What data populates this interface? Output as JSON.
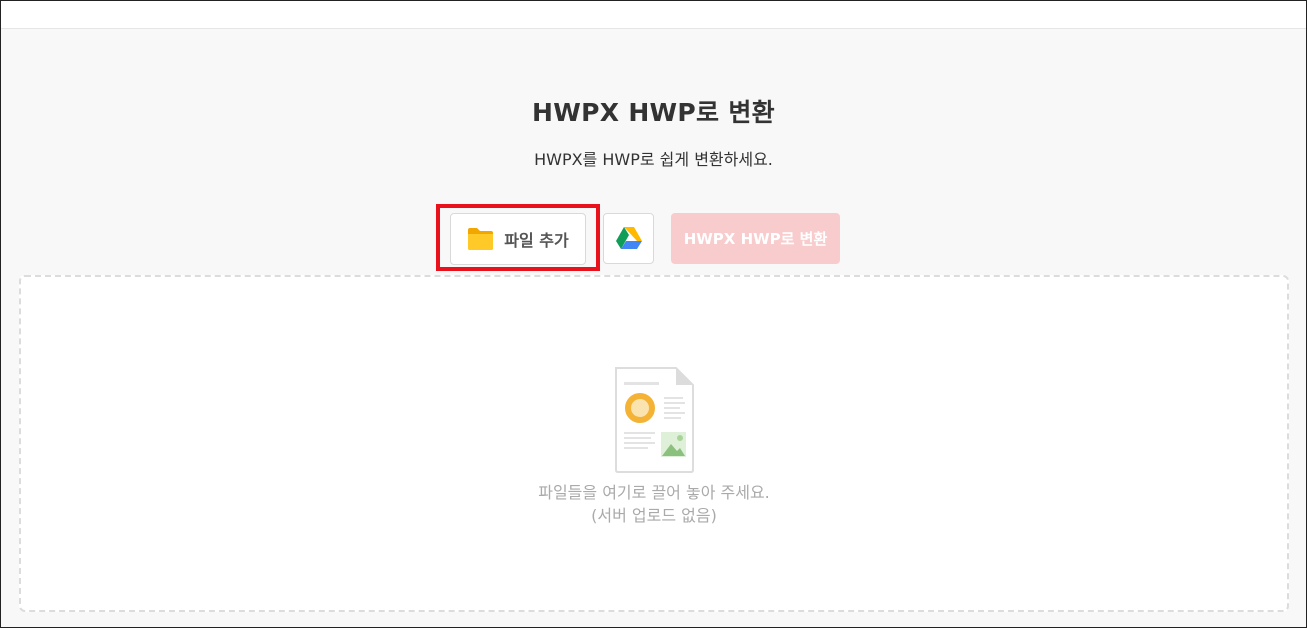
{
  "page": {
    "title": "HWPX HWP로 변환",
    "subtitle": "HWPX를 HWP로 쉽게 변환하세요."
  },
  "toolbar": {
    "add_file_label": "파일 추가",
    "add_file_icon": "folder-icon",
    "google_drive_icon": "google-drive-icon",
    "convert_label": "HWPX HWP로 변환"
  },
  "dropzone": {
    "icon": "document-illustration-icon",
    "hint": "파일들을 여기로 끌어 놓아 주세요.",
    "note": "(서버 업로드 없음)"
  },
  "colors": {
    "highlight": "#e8111c",
    "convert_disabled": "#f8cccd",
    "folder": "#ffc107"
  }
}
